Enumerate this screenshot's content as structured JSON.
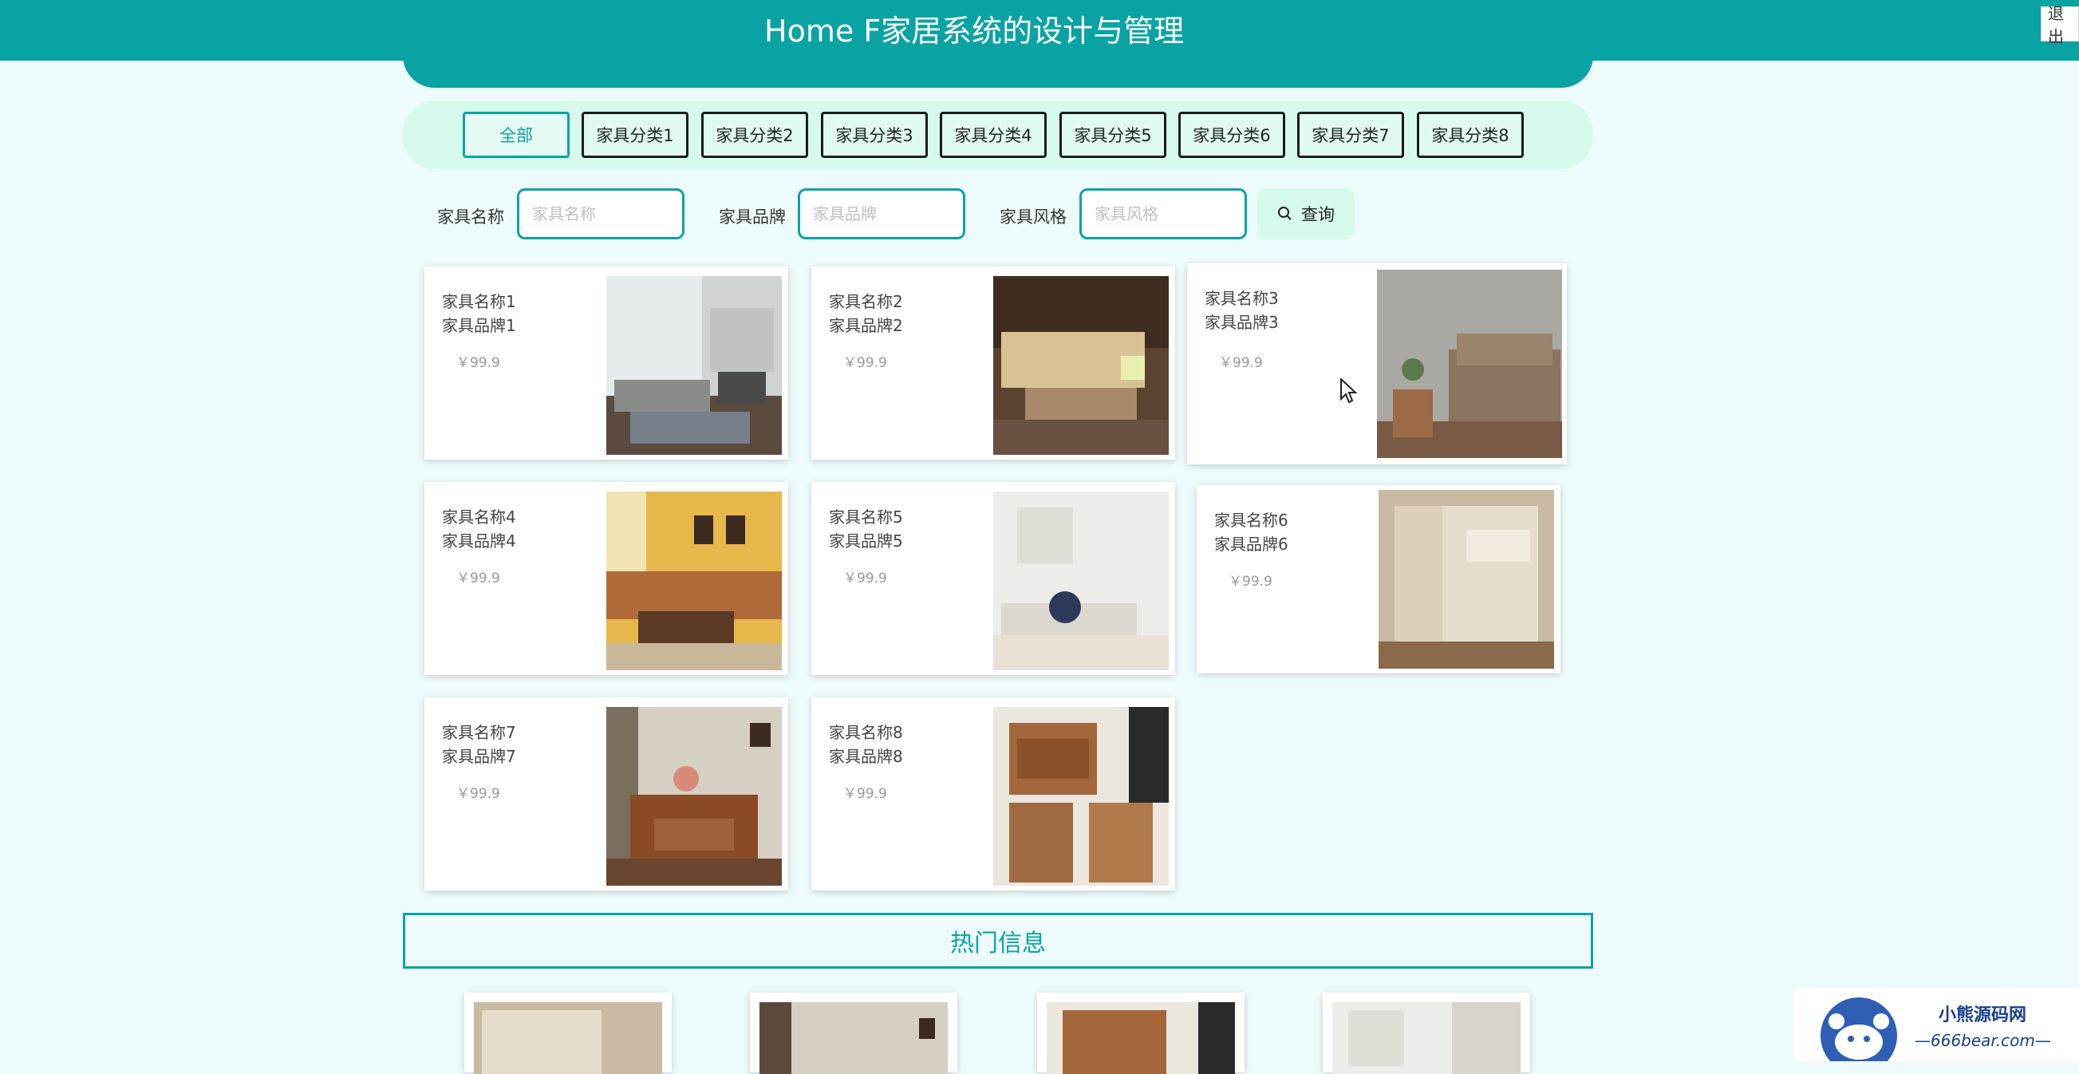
{
  "header": {
    "title": "Home F家居系统的设计与管理",
    "logout_label": "退出"
  },
  "categories": [
    {
      "label": "全部",
      "active": true
    },
    {
      "label": "家具分类1"
    },
    {
      "label": "家具分类2"
    },
    {
      "label": "家具分类3"
    },
    {
      "label": "家具分类4"
    },
    {
      "label": "家具分类5"
    },
    {
      "label": "家具分类6"
    },
    {
      "label": "家具分类7"
    },
    {
      "label": "家具分类8"
    }
  ],
  "search": {
    "name_label": "家具名称",
    "name_placeholder": "家具名称",
    "brand_label": "家具品牌",
    "brand_placeholder": "家具品牌",
    "style_label": "家具风格",
    "style_placeholder": "家具风格",
    "query_label": "查询"
  },
  "products": [
    {
      "name": "家具名称1",
      "brand": "家具品牌1",
      "price": "￥99.9"
    },
    {
      "name": "家具名称2",
      "brand": "家具品牌2",
      "price": "￥99.9"
    },
    {
      "name": "家具名称3",
      "brand": "家具品牌3",
      "price": "￥99.9"
    },
    {
      "name": "家具名称4",
      "brand": "家具品牌4",
      "price": "￥99.9"
    },
    {
      "name": "家具名称5",
      "brand": "家具品牌5",
      "price": "￥99.9"
    },
    {
      "name": "家具名称6",
      "brand": "家具品牌6",
      "price": "￥99.9"
    },
    {
      "name": "家具名称7",
      "brand": "家具品牌7",
      "price": "￥99.9"
    },
    {
      "name": "家具名称8",
      "brand": "家具品牌8",
      "price": "￥99.9"
    }
  ],
  "hot": {
    "title": "热门信息"
  },
  "watermark": {
    "line1": "小熊源码网",
    "line2": "—666bear.com—"
  },
  "colors": {
    "brand": "#0aa3a3",
    "band": "#d6fbec",
    "page_bg": "#eefbfd"
  }
}
